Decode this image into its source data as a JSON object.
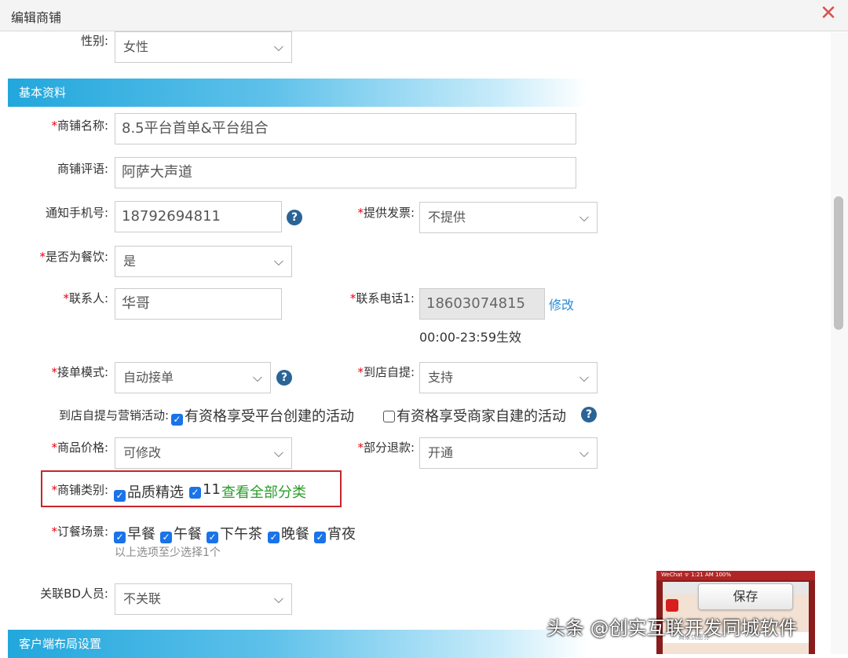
{
  "window": {
    "title": "编辑商铺"
  },
  "gender": {
    "label": "性别:",
    "value": "女性"
  },
  "sections": {
    "basic": "基本资料",
    "client_layout": "客户端布局设置"
  },
  "shop_name": {
    "label": "商铺名称:",
    "value": "8.5平台首单&平台组合"
  },
  "shop_slogan": {
    "label": "商铺评语:",
    "value": "阿萨大声道"
  },
  "notify_phone": {
    "label": "通知手机号:",
    "value": "18792694811"
  },
  "invoice": {
    "label": "提供发票:",
    "value": "不提供"
  },
  "is_food": {
    "label": "是否为餐饮:",
    "value": "是"
  },
  "contact": {
    "label": "联系人:",
    "value": "华哥"
  },
  "contact_phone": {
    "label": "联系电话1:",
    "value": "18603074815",
    "edit": "修改",
    "hours": "00:00-23:59生效"
  },
  "order_mode": {
    "label": "接单模式:",
    "value": "自动接单"
  },
  "self_pickup": {
    "label": "到店自提:",
    "value": "支持"
  },
  "pickup_marketing": {
    "label": "到店自提与营销活动:",
    "option1": "有资格享受平台创建的活动",
    "option2": "有资格享受商家自建的活动"
  },
  "price": {
    "label": "商品价格:",
    "value": "可修改"
  },
  "partial_refund": {
    "label": "部分退款:",
    "value": "开通"
  },
  "category": {
    "label": "商铺类别:",
    "option1": "品质精选",
    "option2": "11",
    "view_all": "查看全部分类"
  },
  "scenes": {
    "label": "订餐场景:",
    "options": [
      "早餐",
      "午餐",
      "下午茶",
      "晚餐",
      "宵夜"
    ],
    "hint": "以上选项至少选择1个"
  },
  "bd": {
    "label": "关联BD人员:",
    "value": "不关联"
  },
  "save": "保存",
  "watermark": "头条 @创实互联开发同城软件",
  "phone_preview": {
    "status": "WeChat ᯤ        1:21 AM        100%",
    "coupon": "商家优惠券"
  },
  "colors": {
    "accent": "#22a7dc",
    "required": "#e60012",
    "highlight_box": "#c9252b",
    "link": "#2a8bd8"
  }
}
